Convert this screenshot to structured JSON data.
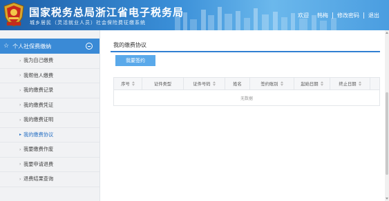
{
  "header": {
    "title": "国家税务总局浙江省电子税务局",
    "subtitle": "城乡居民（灵活就业人员）社会保险费征缴系统",
    "nav": [
      "欢迎",
      "韩梅",
      "修改密码",
      "退出"
    ],
    "brand_color": "#2f7fd2"
  },
  "sidebar": {
    "heading": "个人社保费缴纳",
    "items": [
      {
        "label": "我为自己缴费"
      },
      {
        "label": "我帮他人缴费"
      },
      {
        "label": "我的缴费记录"
      },
      {
        "label": "我的缴费凭证"
      },
      {
        "label": "我的缴费证明"
      },
      {
        "label": "我的缴费协议"
      },
      {
        "label": "我要缴费作废"
      },
      {
        "label": "我要申请退费"
      },
      {
        "label": "退费结果查询"
      }
    ],
    "active_item": "我的缴费协议"
  },
  "main": {
    "title": "我的缴费协议",
    "sign_button": "我要签约",
    "table": {
      "columns": [
        "序号",
        "证件类型",
        "证件号码",
        "姓名",
        "签约账别",
        "起始日期",
        "终止日期"
      ],
      "empty_text": "无数据"
    }
  }
}
